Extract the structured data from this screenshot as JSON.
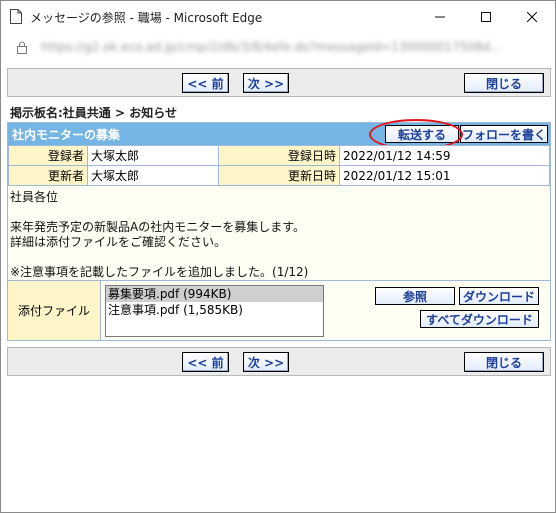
{
  "window": {
    "title": "メッセージの参照 - 職場 - Microsoft Edge",
    "url": "https://g2.ok.eco.ad.jp/cmp/2/db/3/8/4efe.do?messageId=130000017508d..."
  },
  "toolbar": {
    "prev_label": "<< 前",
    "next_label": "次 >>",
    "close_label": "閉じる"
  },
  "breadcrumb": "掲示板名:社員共通 > お知らせ",
  "message": {
    "subject": "社内モニターの募集",
    "forward_label": "転送する",
    "follow_label": "フォローを書く",
    "registrant_label": "登録者",
    "registrant": "大塚太郎",
    "registered_at_label": "登録日時",
    "registered_at": "2022/01/12 14:59",
    "updater_label": "更新者",
    "updater": "大塚太郎",
    "updated_at_label": "更新日時",
    "updated_at": "2022/01/12 15:01",
    "body": [
      "社員各位",
      "",
      "来年発売予定の新製品Aの社内モニターを募集します。",
      "詳細は添付ファイルをご確認ください。",
      "",
      "※注意事項を記載したファイルを追加しました。(1/12)"
    ]
  },
  "attachments": {
    "label": "添付ファイル",
    "files": [
      "募集要項.pdf (994KB)",
      "注意事項.pdf (1,585KB)"
    ],
    "selected_index": 0,
    "browse_label": "参照",
    "download_label": "ダウンロード",
    "download_all_label": "すべてダウンロード"
  },
  "colors": {
    "subject_bar": "#74b5e6",
    "label_cell": "#fff5c8",
    "panel_bg": "#fffef2",
    "button_text": "#1d3f99",
    "highlight": "#e0151c"
  }
}
